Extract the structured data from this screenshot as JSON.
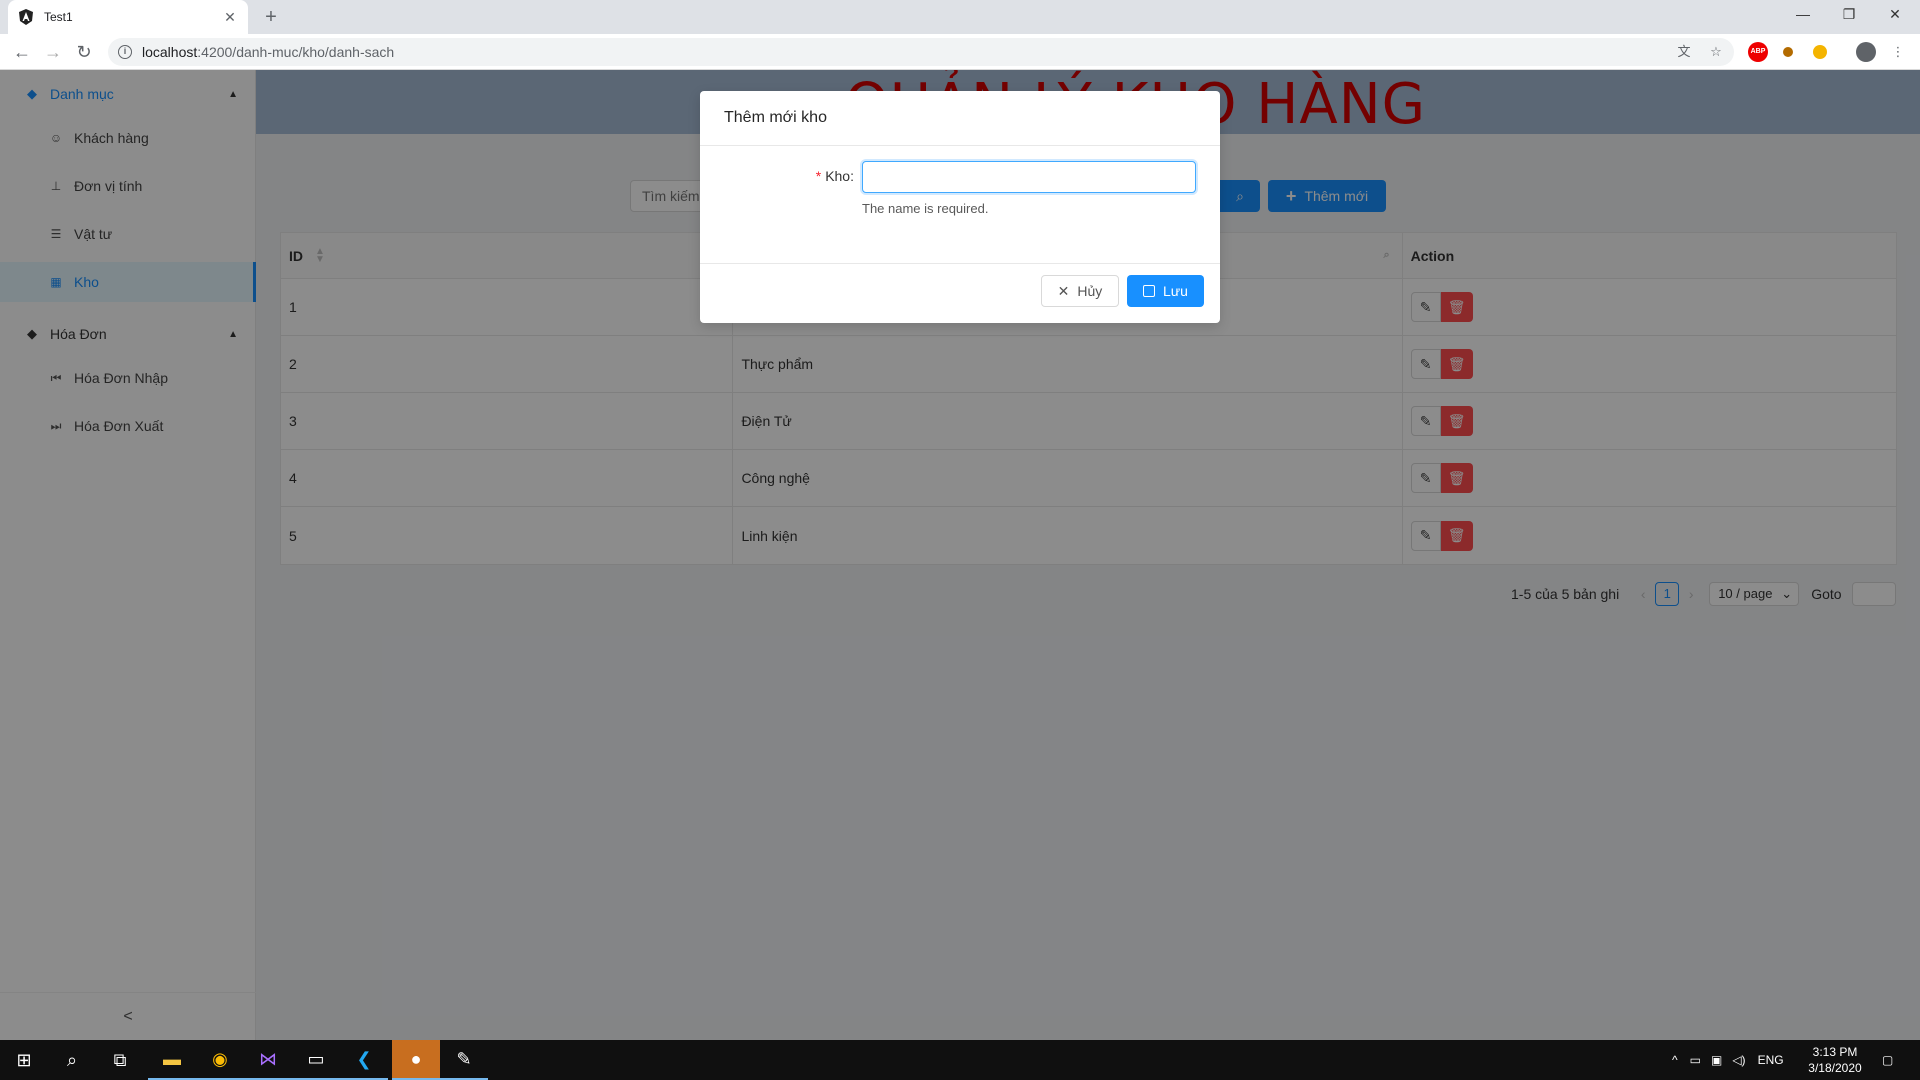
{
  "browser": {
    "tab_title": "Test1",
    "url_host": "localhost",
    "url_rest": ":4200/danh-muc/kho/danh-sach",
    "new_tab": "+"
  },
  "sidebar": {
    "groups": [
      {
        "label": "Danh mục",
        "icon": "gem-icon",
        "expanded": true
      },
      {
        "label": "Hóa Đơn",
        "icon": "gem-icon",
        "expanded": true
      }
    ],
    "items": [
      {
        "label": "Khách hàng",
        "icon": "users-icon"
      },
      {
        "label": "Đơn vị tính",
        "icon": "cluster-icon"
      },
      {
        "label": "Vật tư",
        "icon": "list-icon"
      },
      {
        "label": "Kho",
        "icon": "warehouse-icon",
        "active": true
      },
      {
        "label": "Hóa Đơn Nhập",
        "icon": "step-backward-icon"
      },
      {
        "label": "Hóa Đơn Xuất",
        "icon": "step-forward-icon"
      }
    ],
    "collapse_glyph": "<"
  },
  "header": {
    "title": "QUẢN LÝ KHO HÀNG"
  },
  "toolbar": {
    "search_placeholder": "Tìm kiếm",
    "add_label": "Thêm mới"
  },
  "table": {
    "columns": [
      "ID",
      "",
      "Action"
    ],
    "rows": [
      {
        "id": "1",
        "name": ""
      },
      {
        "id": "2",
        "name": "Thực phẩm"
      },
      {
        "id": "3",
        "name": "Điện Tử"
      },
      {
        "id": "4",
        "name": "Công nghệ"
      },
      {
        "id": "5",
        "name": "Linh kiện"
      }
    ]
  },
  "pagination": {
    "summary": "1-5 của 5 bản ghi",
    "current_page": "1",
    "page_size": "10 / page",
    "goto_label": "Goto"
  },
  "modal": {
    "title": "Thêm mới kho",
    "field_label": "Kho",
    "field_value": "",
    "error": "The name is required.",
    "cancel_label": "Hủy",
    "save_label": "Lưu"
  },
  "taskbar": {
    "time": "3:13 PM",
    "date": "3/18/2020",
    "lang": "ENG"
  },
  "colors": {
    "primary": "#1890ff",
    "danger": "#ff4d4f",
    "title_red": "#d40000",
    "header_bg": "#a7bcd6"
  }
}
